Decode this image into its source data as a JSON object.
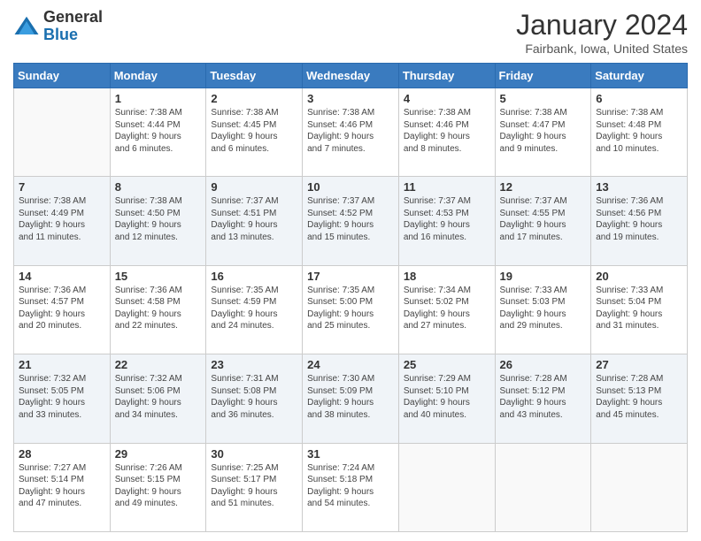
{
  "header": {
    "logo_general": "General",
    "logo_blue": "Blue",
    "month_title": "January 2024",
    "subtitle": "Fairbank, Iowa, United States"
  },
  "days_of_week": [
    "Sunday",
    "Monday",
    "Tuesday",
    "Wednesday",
    "Thursday",
    "Friday",
    "Saturday"
  ],
  "weeks": [
    [
      {
        "num": "",
        "content": ""
      },
      {
        "num": "1",
        "content": "Sunrise: 7:38 AM\nSunset: 4:44 PM\nDaylight: 9 hours\nand 6 minutes."
      },
      {
        "num": "2",
        "content": "Sunrise: 7:38 AM\nSunset: 4:45 PM\nDaylight: 9 hours\nand 6 minutes."
      },
      {
        "num": "3",
        "content": "Sunrise: 7:38 AM\nSunset: 4:46 PM\nDaylight: 9 hours\nand 7 minutes."
      },
      {
        "num": "4",
        "content": "Sunrise: 7:38 AM\nSunset: 4:46 PM\nDaylight: 9 hours\nand 8 minutes."
      },
      {
        "num": "5",
        "content": "Sunrise: 7:38 AM\nSunset: 4:47 PM\nDaylight: 9 hours\nand 9 minutes."
      },
      {
        "num": "6",
        "content": "Sunrise: 7:38 AM\nSunset: 4:48 PM\nDaylight: 9 hours\nand 10 minutes."
      }
    ],
    [
      {
        "num": "7",
        "content": "Sunrise: 7:38 AM\nSunset: 4:49 PM\nDaylight: 9 hours\nand 11 minutes."
      },
      {
        "num": "8",
        "content": "Sunrise: 7:38 AM\nSunset: 4:50 PM\nDaylight: 9 hours\nand 12 minutes."
      },
      {
        "num": "9",
        "content": "Sunrise: 7:37 AM\nSunset: 4:51 PM\nDaylight: 9 hours\nand 13 minutes."
      },
      {
        "num": "10",
        "content": "Sunrise: 7:37 AM\nSunset: 4:52 PM\nDaylight: 9 hours\nand 15 minutes."
      },
      {
        "num": "11",
        "content": "Sunrise: 7:37 AM\nSunset: 4:53 PM\nDaylight: 9 hours\nand 16 minutes."
      },
      {
        "num": "12",
        "content": "Sunrise: 7:37 AM\nSunset: 4:55 PM\nDaylight: 9 hours\nand 17 minutes."
      },
      {
        "num": "13",
        "content": "Sunrise: 7:36 AM\nSunset: 4:56 PM\nDaylight: 9 hours\nand 19 minutes."
      }
    ],
    [
      {
        "num": "14",
        "content": "Sunrise: 7:36 AM\nSunset: 4:57 PM\nDaylight: 9 hours\nand 20 minutes."
      },
      {
        "num": "15",
        "content": "Sunrise: 7:36 AM\nSunset: 4:58 PM\nDaylight: 9 hours\nand 22 minutes."
      },
      {
        "num": "16",
        "content": "Sunrise: 7:35 AM\nSunset: 4:59 PM\nDaylight: 9 hours\nand 24 minutes."
      },
      {
        "num": "17",
        "content": "Sunrise: 7:35 AM\nSunset: 5:00 PM\nDaylight: 9 hours\nand 25 minutes."
      },
      {
        "num": "18",
        "content": "Sunrise: 7:34 AM\nSunset: 5:02 PM\nDaylight: 9 hours\nand 27 minutes."
      },
      {
        "num": "19",
        "content": "Sunrise: 7:33 AM\nSunset: 5:03 PM\nDaylight: 9 hours\nand 29 minutes."
      },
      {
        "num": "20",
        "content": "Sunrise: 7:33 AM\nSunset: 5:04 PM\nDaylight: 9 hours\nand 31 minutes."
      }
    ],
    [
      {
        "num": "21",
        "content": "Sunrise: 7:32 AM\nSunset: 5:05 PM\nDaylight: 9 hours\nand 33 minutes."
      },
      {
        "num": "22",
        "content": "Sunrise: 7:32 AM\nSunset: 5:06 PM\nDaylight: 9 hours\nand 34 minutes."
      },
      {
        "num": "23",
        "content": "Sunrise: 7:31 AM\nSunset: 5:08 PM\nDaylight: 9 hours\nand 36 minutes."
      },
      {
        "num": "24",
        "content": "Sunrise: 7:30 AM\nSunset: 5:09 PM\nDaylight: 9 hours\nand 38 minutes."
      },
      {
        "num": "25",
        "content": "Sunrise: 7:29 AM\nSunset: 5:10 PM\nDaylight: 9 hours\nand 40 minutes."
      },
      {
        "num": "26",
        "content": "Sunrise: 7:28 AM\nSunset: 5:12 PM\nDaylight: 9 hours\nand 43 minutes."
      },
      {
        "num": "27",
        "content": "Sunrise: 7:28 AM\nSunset: 5:13 PM\nDaylight: 9 hours\nand 45 minutes."
      }
    ],
    [
      {
        "num": "28",
        "content": "Sunrise: 7:27 AM\nSunset: 5:14 PM\nDaylight: 9 hours\nand 47 minutes."
      },
      {
        "num": "29",
        "content": "Sunrise: 7:26 AM\nSunset: 5:15 PM\nDaylight: 9 hours\nand 49 minutes."
      },
      {
        "num": "30",
        "content": "Sunrise: 7:25 AM\nSunset: 5:17 PM\nDaylight: 9 hours\nand 51 minutes."
      },
      {
        "num": "31",
        "content": "Sunrise: 7:24 AM\nSunset: 5:18 PM\nDaylight: 9 hours\nand 54 minutes."
      },
      {
        "num": "",
        "content": ""
      },
      {
        "num": "",
        "content": ""
      },
      {
        "num": "",
        "content": ""
      }
    ]
  ]
}
